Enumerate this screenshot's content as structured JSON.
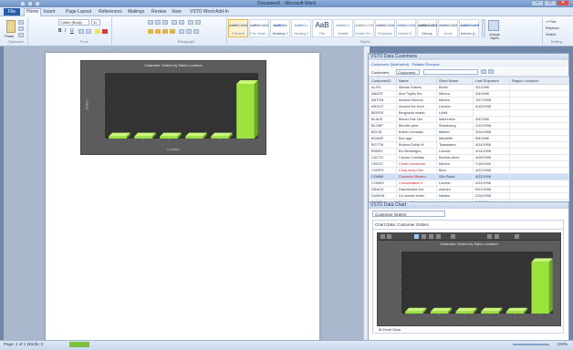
{
  "window": {
    "title": "Document1 - Microsoft Word",
    "file_tab": "File",
    "controls": [
      "–",
      "□",
      "✕"
    ]
  },
  "tabs": [
    "Home",
    "Insert",
    "Page Layout",
    "References",
    "Mailings",
    "Review",
    "View",
    "VSTO Word Add-In"
  ],
  "ribbon": {
    "clipboard": {
      "label": "Clipboard",
      "paste": "Paste"
    },
    "font": {
      "label": "Font",
      "name": "Calibri (Body)",
      "size": "11"
    },
    "paragraph": {
      "label": "Paragraph"
    },
    "styles": {
      "label": "Styles",
      "tiles": [
        {
          "sample": "AaBbCcDd",
          "name": "¶ Normal"
        },
        {
          "sample": "AaBbCcDd",
          "name": "¶ No Spaci..."
        },
        {
          "sample": "AaBbCc",
          "name": "Heading 1"
        },
        {
          "sample": "AaBbCc",
          "name": "Heading 2"
        },
        {
          "sample": "AaB",
          "name": "Title"
        },
        {
          "sample": "AaBbCc.",
          "name": "Subtitle"
        },
        {
          "sample": "AaBbCcDd",
          "name": "Subtle Em..."
        },
        {
          "sample": "AaBbCcDd",
          "name": "Emphasis"
        },
        {
          "sample": "AaBbCcDd",
          "name": "Intense E..."
        },
        {
          "sample": "AaBbCcDd",
          "name": "Strong"
        },
        {
          "sample": "AaBbCcDd",
          "name": "Quote"
        },
        {
          "sample": "AaBbCcDd",
          "name": "Intense Q..."
        }
      ],
      "change": "Change Styles"
    },
    "editing": {
      "label": "Editing",
      "find": "Find",
      "replace": "Replace",
      "select": "Select"
    }
  },
  "document": {
    "chart": {
      "title": "Customer Orders by Sales Location",
      "ylabel": "Orders",
      "xlabel": "Location"
    }
  },
  "data_pane": {
    "title": "VSTO Data Customers",
    "toolbar": "Customers (Northwind) · Related Records",
    "filter_label": "Customers",
    "filter_value": "Customers",
    "columns": [
      "CustomerID",
      "Name",
      "Short Name",
      "Last Shipment",
      "Region Location"
    ],
    "rows": [
      [
        "ALFKI",
        "Alfreds Futterk.",
        "Berlin",
        "3/2/1998",
        ""
      ],
      [
        "ANATR",
        "Ana Trujillo Em.",
        "México",
        "3/4/1998",
        ""
      ],
      [
        "ANTON",
        "Antonio Moreno",
        "México",
        "1/27/1998",
        ""
      ],
      [
        "AROUT",
        "Around the Horn",
        "London",
        "4/10/1998",
        ""
      ],
      [
        "BERGS",
        "Berglunds snabb.",
        "Luleå",
        "",
        ""
      ],
      [
        "BLAUS",
        "Blauer See Del.",
        "Mannheim",
        "4/9/1998",
        ""
      ],
      [
        "BLONP",
        "Blondel père.",
        "Strasbourg",
        "1/12/1998",
        ""
      ],
      [
        "BOLID",
        "Bólido Comidas",
        "Madrid",
        "3/24/1998",
        ""
      ],
      [
        "BONAP",
        "Bon app'",
        "Marseille",
        "5/6/1998",
        ""
      ],
      [
        "BOTTM",
        "Bottom-Dollar M.",
        "Tsawassen",
        "4/24/1998",
        ""
      ],
      [
        "BSBEV",
        "B's Beverages",
        "London",
        "4/14/1998",
        ""
      ],
      [
        "CACTU",
        "Cactus Comidas",
        "Buenos Aires",
        "4/28/1998",
        ""
      ],
      [
        "CENTC",
        "Centro comercial",
        "México",
        "7/18/1996",
        ""
      ],
      [
        "CHOPS",
        "Chop-suey Chin.",
        "Bern",
        "4/22/1998",
        ""
      ],
      [
        "COMMI",
        "Comércio Mineiro",
        "São Paulo",
        "4/22/1998",
        ""
      ],
      [
        "CONSH",
        "Consolidated H.",
        "London",
        "4/23/1998",
        ""
      ],
      [
        "DRACD",
        "Drachenblut Del.",
        "Aachen",
        "5/21/1998",
        ""
      ],
      [
        "DUMON",
        "Du monde entier",
        "Nantes",
        "2/26/1998",
        ""
      ],
      [
        "EASTC",
        "Eastern Connect.",
        "London",
        "5/4/1998",
        ""
      ],
      [
        "ERNSH",
        "Ernst Handel",
        "Graz",
        "5/5/1998",
        ""
      ]
    ],
    "selected_row": 14
  },
  "chart_pane": {
    "title": "VSTO Data Chart",
    "field": "Customer Orders",
    "subtitle": "Chart Data: Customer Orders",
    "node": "Excel Data"
  },
  "status": {
    "page": "Page: 1 of 1",
    "words": "Words: 0",
    "zoom": "100%"
  },
  "chart_data": {
    "type": "bar",
    "title": "Customer Orders by Sales Location",
    "categories": [
      "",
      "",
      "",
      "",
      "",
      ""
    ],
    "values": [
      4,
      4,
      4,
      4,
      4,
      100
    ],
    "ylim": [
      0,
      120
    ],
    "grid": false,
    "style": {
      "background": "#333333",
      "bar_color": "#9be33c",
      "bar_top": "#c8f57a"
    }
  }
}
